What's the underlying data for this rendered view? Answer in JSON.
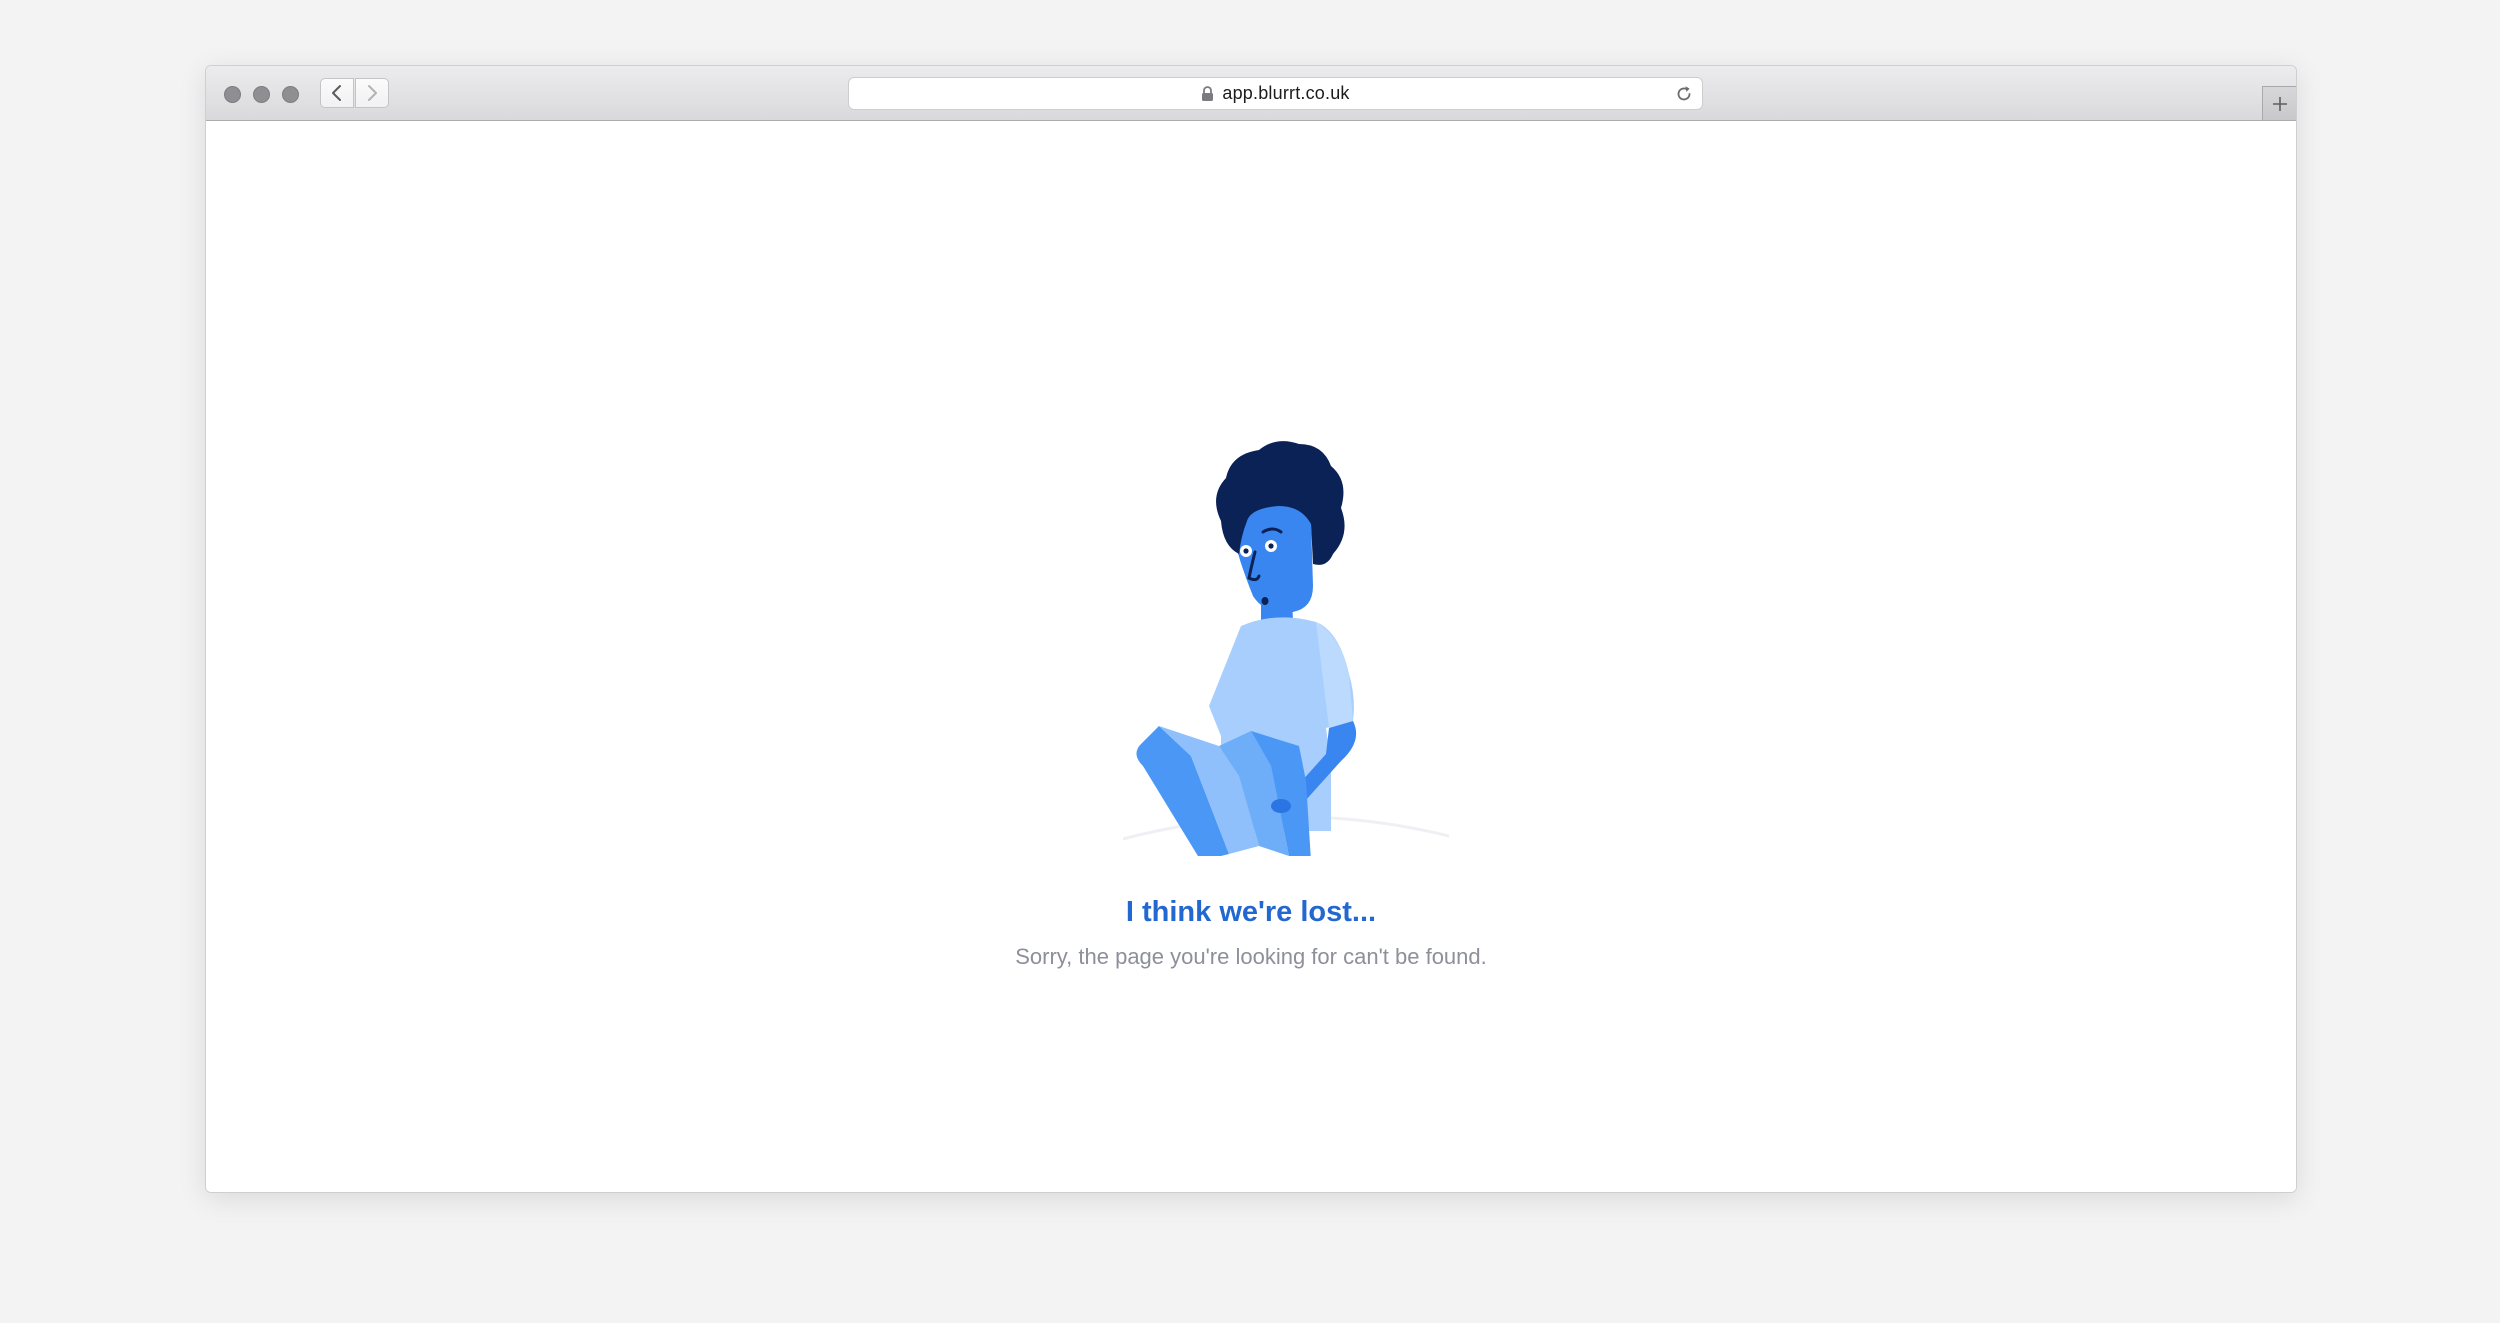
{
  "browser": {
    "url": "app.blurrt.co.uk",
    "icons": {
      "back": "chevron-left-icon",
      "forward": "chevron-right-icon",
      "lock": "lock-icon",
      "reload": "reload-icon",
      "new_tab": "plus-icon"
    }
  },
  "page": {
    "headline": "I think we're lost...",
    "message": "Sorry, the page you're looking for can't be found."
  },
  "colors": {
    "headline": "#2367d1",
    "message": "#8d9099",
    "hair": "#0b2256",
    "skin": "#3a86f0",
    "shirt": "#a8cefd",
    "map_light": "#8fc0fb",
    "map_dark": "#4b97f5"
  }
}
